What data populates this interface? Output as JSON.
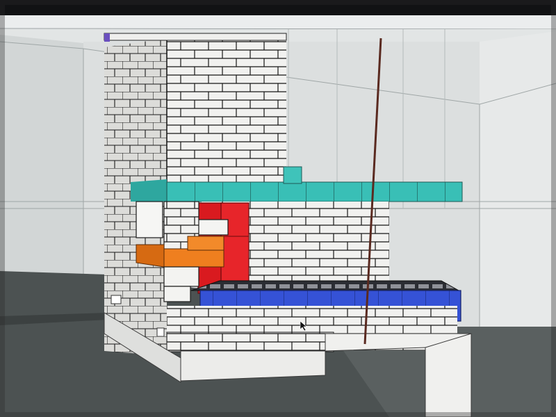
{
  "scene": {
    "subject": "3d-brick-model",
    "viewport_bg": "#e4e6e6",
    "floor_color": "#4a4f4f",
    "brick_color": "#f2f2f0",
    "accent_colors": {
      "teal": "#3fc1b8",
      "red": "#e01f24",
      "orange": "#ee7d1e",
      "blue": "#3a54d6",
      "grate": "#2a2c30",
      "cable": "#5a2a20"
    }
  }
}
